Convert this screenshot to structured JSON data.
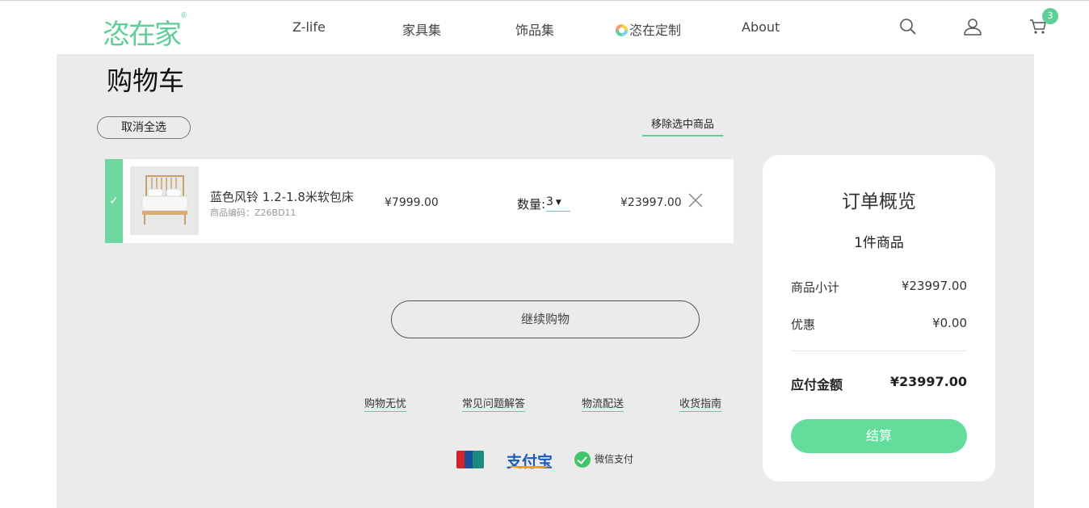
{
  "header": {
    "logo": "恣在家",
    "nav": [
      "Z-life",
      "家具集",
      "饰品集",
      "恣在定制",
      "About"
    ],
    "cart_count": "3"
  },
  "cart": {
    "title": "购物车",
    "deselect_all": "取消全选",
    "remove_selected": "移除选中商品",
    "items": [
      {
        "selected": true,
        "check": "✓",
        "name": "蓝色风铃 1.2-1.8米软包床",
        "code": "商品编码：Z26BD11",
        "unit_price": "¥7999.00",
        "qty_label": "数量:",
        "qty": "3",
        "line_total": "¥23997.00"
      }
    ],
    "continue_shopping": "继续购物"
  },
  "footer": {
    "links": [
      "购物无忧",
      "常见问题解答",
      "物流配送",
      "收货指南"
    ],
    "payments": {
      "alipay": "支付宝",
      "wechat": "微信支付"
    }
  },
  "summary": {
    "title": "订单概览",
    "count": "1件商品",
    "subtotal_label": "商品小计",
    "subtotal": "¥23997.00",
    "discount_label": "优惠",
    "discount": "¥0.00",
    "total_label": "应付金额",
    "total": "¥23997.00",
    "checkout": "结算"
  },
  "colors": {
    "accent": "#5fcf97",
    "panel_bg": "#ebebeb"
  }
}
